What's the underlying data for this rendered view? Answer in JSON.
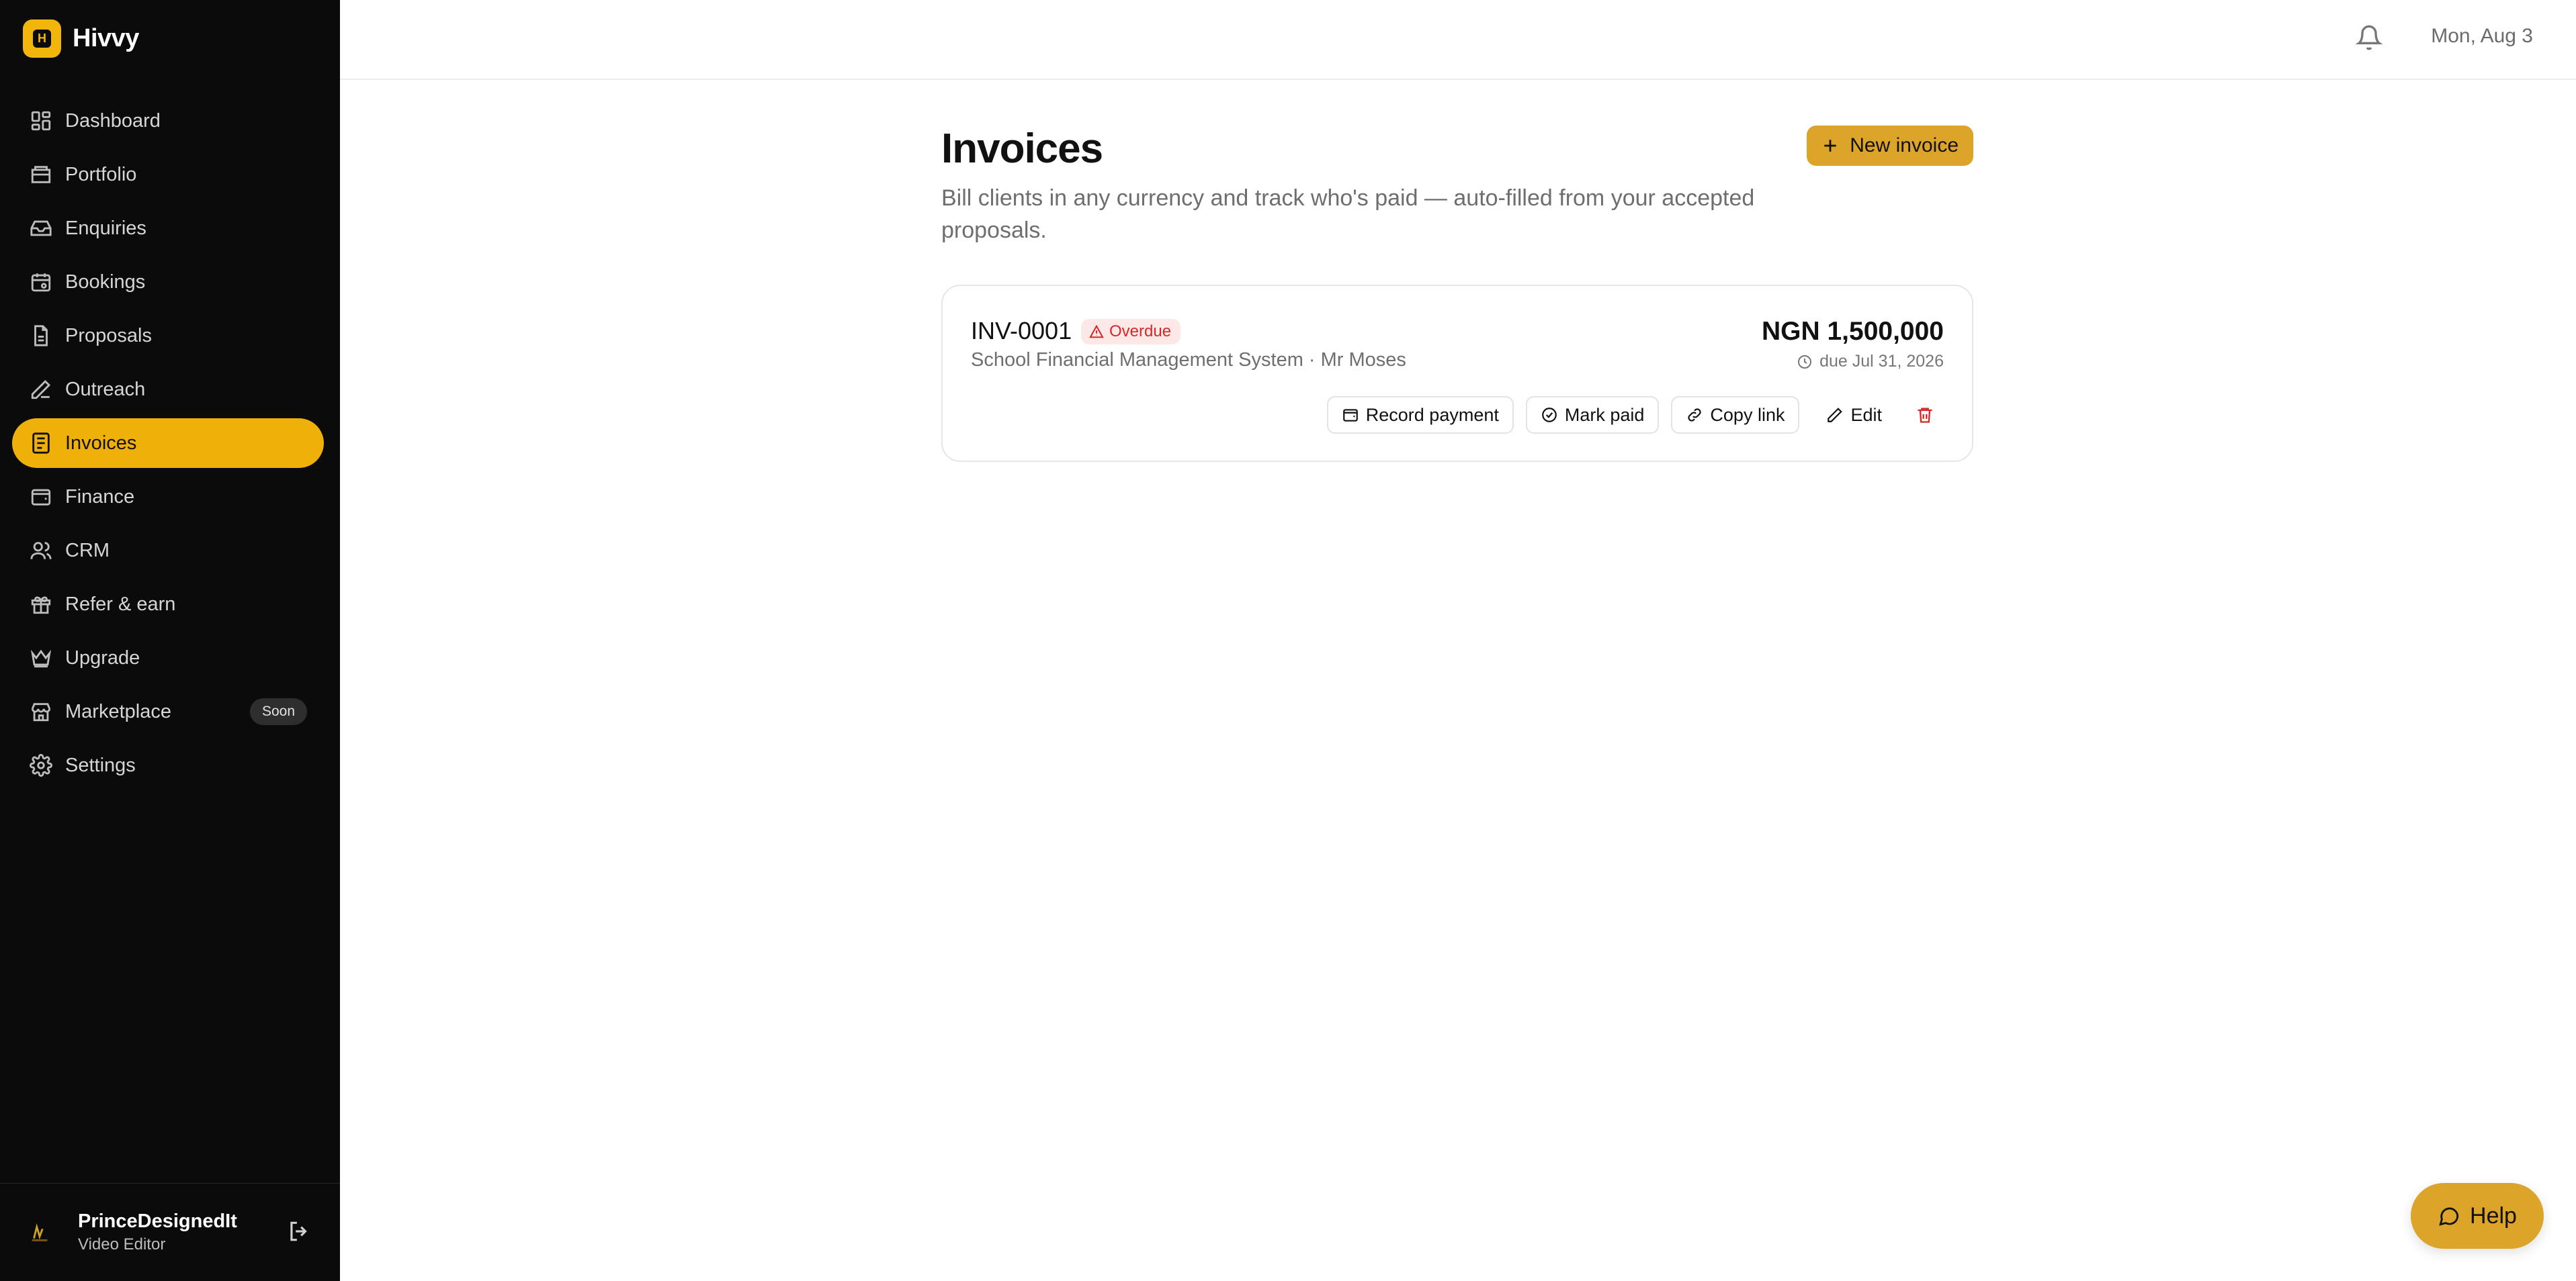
{
  "brand": {
    "name": "Hivvy",
    "mark": "H"
  },
  "nav": {
    "items": [
      {
        "label": "Dashboard",
        "icon": "dashboard-icon"
      },
      {
        "label": "Portfolio",
        "icon": "portfolio-icon"
      },
      {
        "label": "Enquiries",
        "icon": "inbox-icon"
      },
      {
        "label": "Bookings",
        "icon": "calendar-icon"
      },
      {
        "label": "Proposals",
        "icon": "document-icon"
      },
      {
        "label": "Outreach",
        "icon": "pen-icon"
      },
      {
        "label": "Invoices",
        "icon": "invoice-icon",
        "active": true
      },
      {
        "label": "Finance",
        "icon": "wallet-icon"
      },
      {
        "label": "CRM",
        "icon": "users-icon"
      },
      {
        "label": "Refer & earn",
        "icon": "gift-icon"
      },
      {
        "label": "Upgrade",
        "icon": "crown-icon"
      },
      {
        "label": "Marketplace",
        "icon": "store-icon",
        "badge": "Soon"
      },
      {
        "label": "Settings",
        "icon": "gear-icon"
      }
    ]
  },
  "user": {
    "name": "PrinceDesignedIt",
    "role": "Video Editor"
  },
  "topbar": {
    "date": "Mon, Aug 3"
  },
  "page": {
    "title": "Invoices",
    "description": "Bill clients in any currency and track who's paid — auto-filled from your accepted proposals.",
    "new_button": "New invoice"
  },
  "invoice": {
    "id": "INV-0001",
    "status": "Overdue",
    "subtitle": "School Financial Management System · Mr Moses",
    "amount": "NGN 1,500,000",
    "due": "due Jul 31, 2026",
    "actions": {
      "record_payment": "Record payment",
      "mark_paid": "Mark paid",
      "copy_link": "Copy link",
      "edit": "Edit"
    }
  },
  "help": {
    "label": "Help"
  },
  "colors": {
    "accent": "#f0b00a",
    "button_gold": "#dca428",
    "sidebar_bg": "#0b0b0b",
    "danger": "#d62828"
  }
}
